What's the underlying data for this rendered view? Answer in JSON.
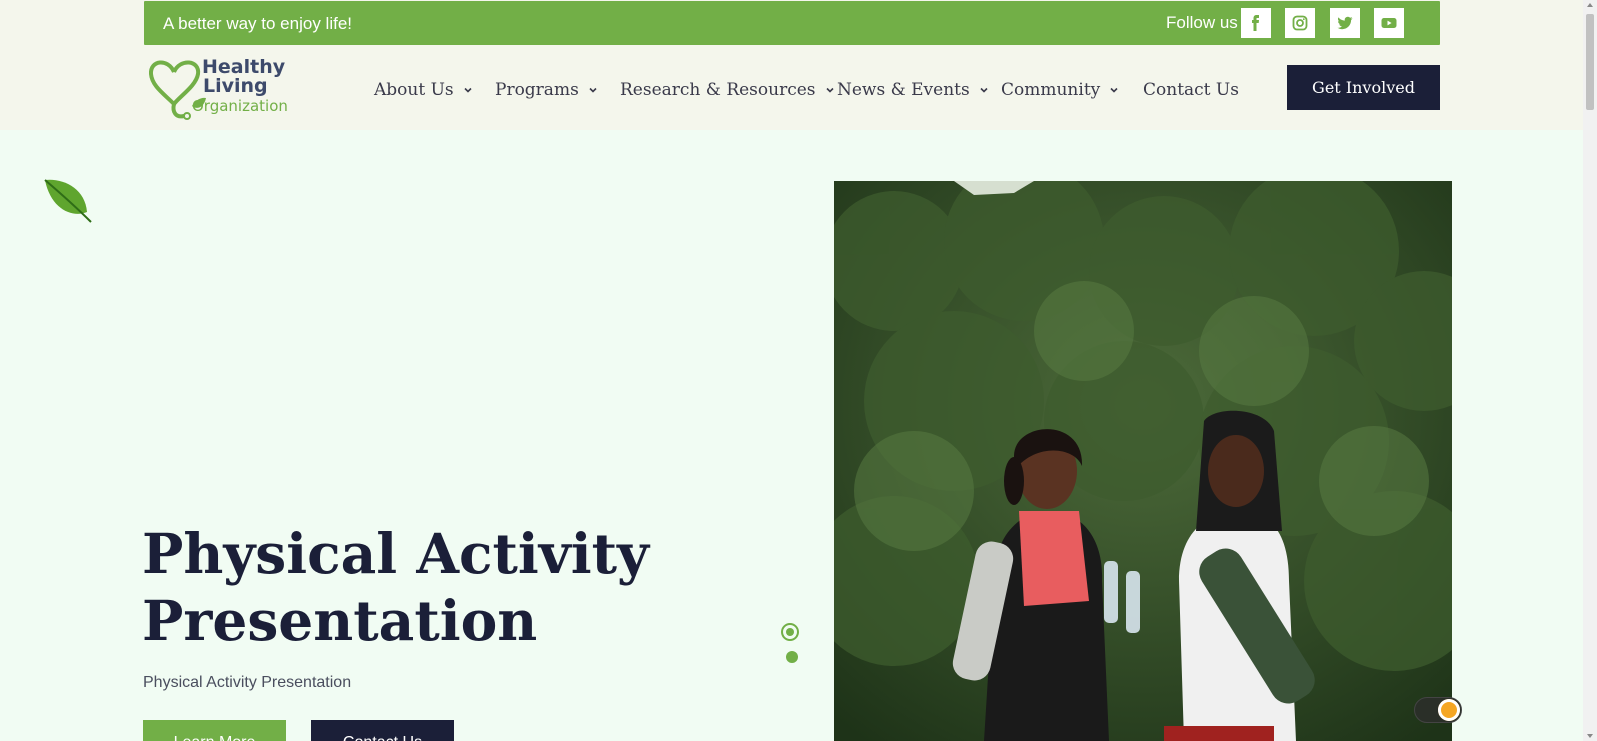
{
  "topbar": {
    "tagline": "A better way to enjoy life!",
    "follow_label": "Follow us :",
    "socials": [
      "facebook-icon",
      "instagram-icon",
      "twitter-icon",
      "youtube-icon"
    ]
  },
  "logo": {
    "line1": "Healthy",
    "line2": "Living",
    "line3": "Organization"
  },
  "nav": {
    "items": [
      {
        "label": "About Us"
      },
      {
        "label": "Programs"
      },
      {
        "label": "Research & Resources"
      },
      {
        "label": "News & Events"
      },
      {
        "label": "Community"
      },
      {
        "label": "Contact Us"
      }
    ],
    "cta": "Get Involved"
  },
  "hero": {
    "title_line1": "Physical Activity",
    "title_line2": "Presentation",
    "subtitle": "Physical Activity Presentation",
    "primary_button": "Learn More",
    "secondary_button": "Contact Us",
    "slides": 2,
    "active_slide": 1
  },
  "colors": {
    "brand_green": "#72af47",
    "navy": "#1b1f38",
    "hero_bg": "#f1fcf3",
    "header_bg": "#f4f6ec"
  }
}
